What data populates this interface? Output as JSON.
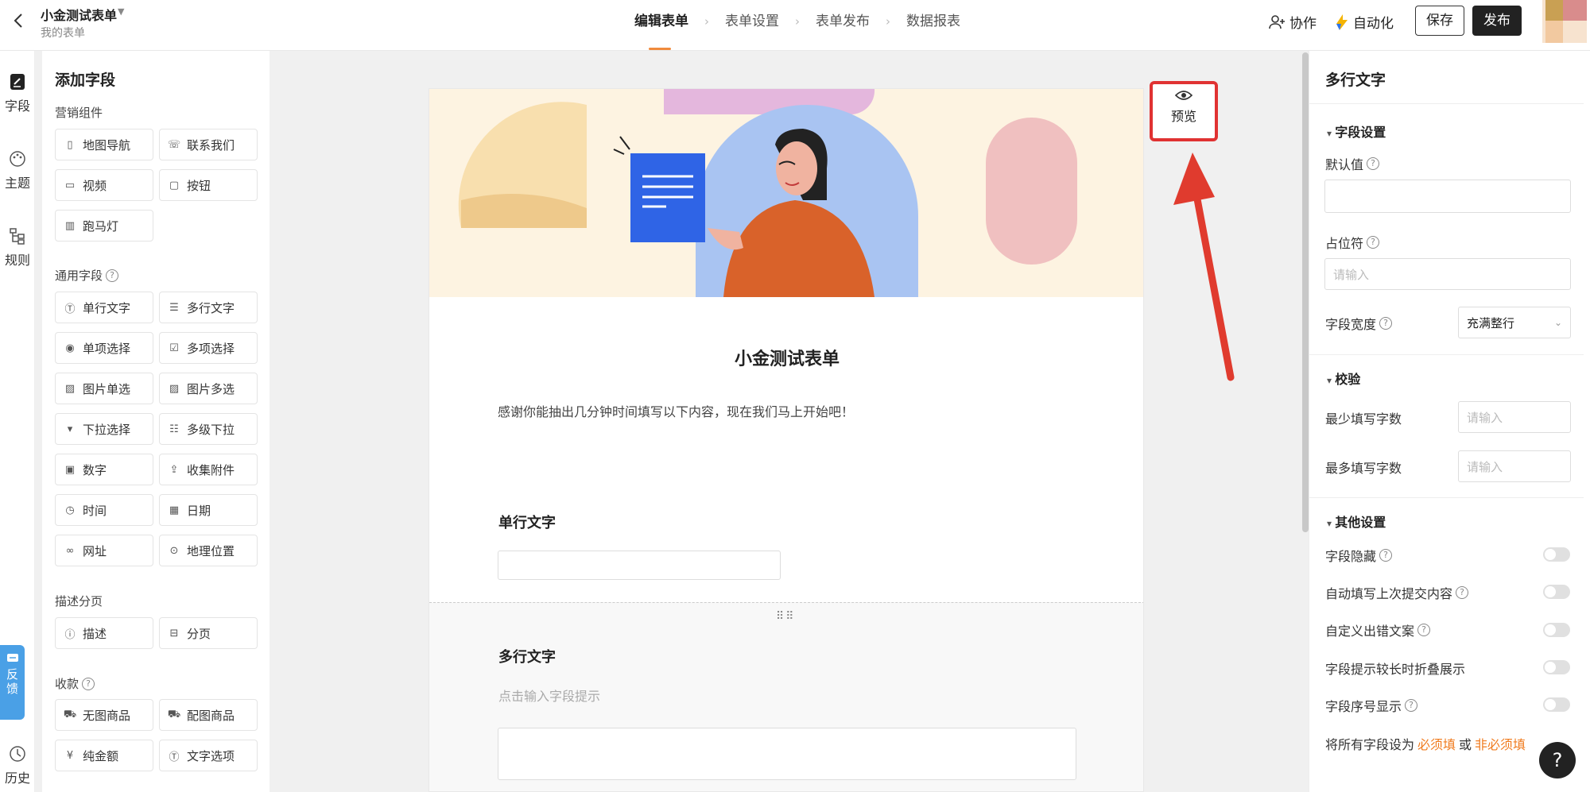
{
  "header": {
    "title": "小金测试表单",
    "subtitle": "我的表单",
    "steps": [
      "编辑表单",
      "表单设置",
      "表单发布",
      "数据报表"
    ],
    "collab_label": "协作",
    "automation_label": "自动化",
    "save_label": "保存",
    "publish_label": "发布"
  },
  "leftnav": {
    "fields_label": "字段",
    "theme_label": "主题",
    "rules_label": "规则",
    "feedback_label": "反馈",
    "history_label": "历史"
  },
  "panel": {
    "title": "添加字段",
    "marketing": {
      "label": "营销组件",
      "items": [
        "地图导航",
        "联系我们",
        "视频",
        "按钮",
        "跑马灯"
      ]
    },
    "common": {
      "label": "通用字段",
      "items": [
        "单行文字",
        "多行文字",
        "单项选择",
        "多项选择",
        "图片单选",
        "图片多选",
        "下拉选择",
        "多级下拉",
        "数字",
        "收集附件",
        "时间",
        "日期",
        "网址",
        "地理位置"
      ]
    },
    "desc_page": {
      "label": "描述分页",
      "items": [
        "描述",
        "分页"
      ]
    },
    "payment": {
      "label": "收款",
      "items": [
        "无图商品",
        "配图商品",
        "纯金额",
        "文字选项"
      ]
    }
  },
  "form": {
    "title": "小金测试表单",
    "description": "感谢你能抽出几分钟时间填写以下内容，现在我们马上开始吧！",
    "field1_label": "单行文字",
    "field2_label": "多行文字",
    "field2_hint": "点击输入字段提示"
  },
  "preview": {
    "label": "预览"
  },
  "rpanel": {
    "title": "多行文字",
    "field_settings": "字段设置",
    "default_value": "默认值",
    "placeholder_label": "占位符",
    "placeholder_input": "请输入",
    "width_label": "字段宽度",
    "width_value": "充满整行",
    "validation": "校验",
    "min_chars": "最少填写字数",
    "max_chars": "最多填写字数",
    "min_placeholder": "请输入",
    "max_placeholder": "请输入",
    "other": "其他设置",
    "hide_field": "字段隐藏",
    "autofill": "自动填写上次提交内容",
    "custom_error": "自定义出错文案",
    "fold_hint": "字段提示较长时折叠展示",
    "show_index": "字段序号显示",
    "bulk_prefix": "将所有字段设为",
    "required": "必须填",
    "or": "或",
    "optional": "非必须填"
  },
  "help": "?",
  "colors": {
    "accent": "#f07b1e",
    "highlight": "#e03232",
    "feedback": "#4aa0e6"
  }
}
